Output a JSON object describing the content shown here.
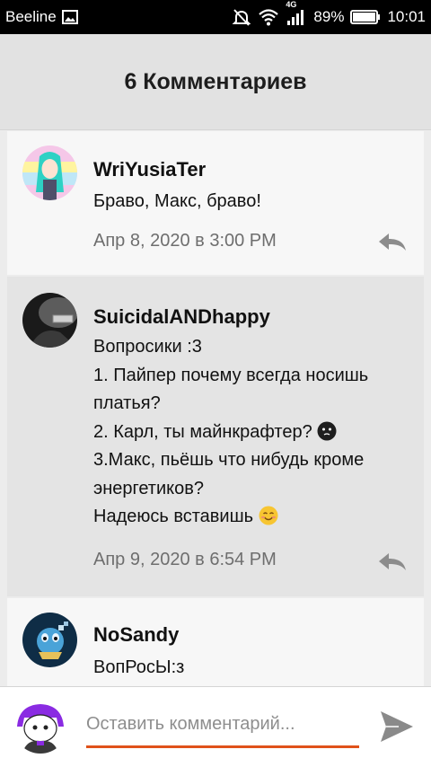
{
  "status_bar": {
    "carrier": "Beeline",
    "network_type": "4G",
    "battery": "89%",
    "time": "10:01",
    "icons": [
      "image-icon",
      "mute-icon",
      "wifi-icon",
      "signal-icon",
      "battery-icon"
    ]
  },
  "header": {
    "title": "6 Комментариев"
  },
  "comments": [
    {
      "author": "WriYusiaTer",
      "lines": [
        "Браво, Макс, браво!"
      ],
      "date": "Апр 8, 2020 в 3:00 PM"
    },
    {
      "author": "SuicidalANDhappy",
      "lines": [
        "Вопросики :3",
        "1. Пайпер почему всегда носишь",
        "платья?",
        "2. Карл, ты майнкрафтер?",
        "3.Макс, пьёшь что нибудь кроме",
        "энергетиков?",
        "Надеюсь вставишь"
      ],
      "date": "Апр 9, 2020 в 6:54 PM"
    },
    {
      "author": "NoSandy",
      "lines": [
        "ВопРосЫ:з"
      ],
      "date": ""
    }
  ],
  "composer": {
    "placeholder": "Оставить комментарий..."
  },
  "colors": {
    "accent": "#e0521a",
    "header_bg": "#e2e2e2",
    "highlight_bg": "#e4e4e4",
    "date_text": "#6e6e6e"
  }
}
